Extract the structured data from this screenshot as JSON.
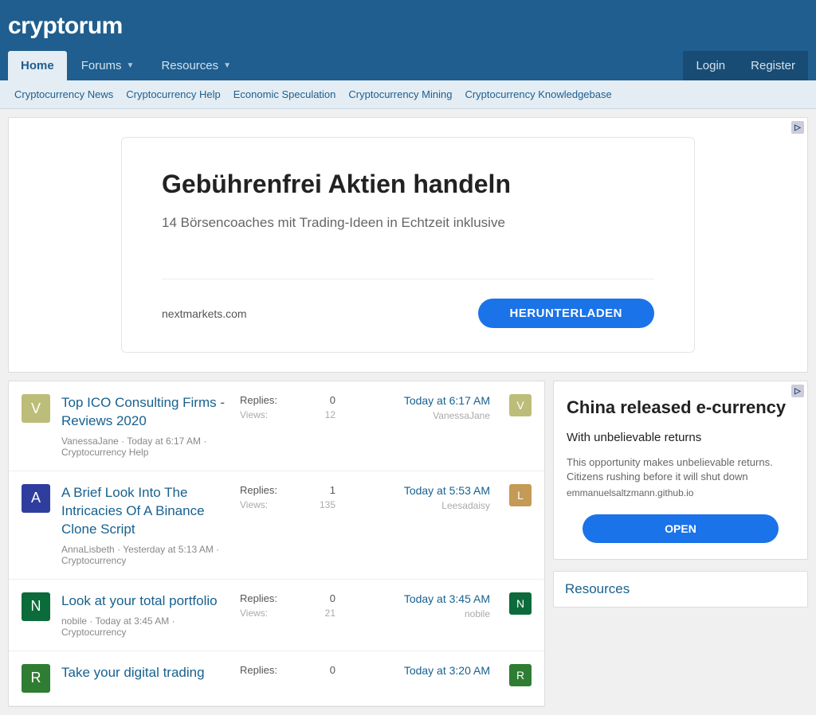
{
  "brand": "cryptorum",
  "nav": {
    "tabs": [
      {
        "label": "Home",
        "active": true,
        "dropdown": false
      },
      {
        "label": "Forums",
        "active": false,
        "dropdown": true
      },
      {
        "label": "Resources",
        "active": false,
        "dropdown": true
      }
    ],
    "login": "Login",
    "register": "Register"
  },
  "subnav": [
    "Cryptocurrency News",
    "Cryptocurrency Help",
    "Economic Speculation",
    "Cryptocurrency Mining",
    "Cryptocurrency Knowledgebase"
  ],
  "top_ad": {
    "title": "Gebührenfrei Aktien handeln",
    "subtitle": "14 Börsencoaches mit Trading-Ideen in Echtzeit inklusive",
    "domain": "nextmarkets.com",
    "cta": "HERUNTERLADEN"
  },
  "labels": {
    "replies": "Replies:",
    "views": "Views:"
  },
  "threads": [
    {
      "title": "Top ICO Consulting Firms - Reviews 2020",
      "author": "VanessaJane",
      "posted": "Today at 6:17 AM",
      "forum": "Cryptocurrency Help",
      "replies": "0",
      "views": "12",
      "last_time": "Today at 6:17 AM",
      "last_user": "VanessaJane",
      "av_letter": "V",
      "av_color": "#bdbd7a",
      "mini_letter": "V",
      "mini_color": "#bdbd7a"
    },
    {
      "title": "A Brief Look Into The Intricacies Of A Binance Clone Script",
      "author": "AnnaLisbeth",
      "posted": "Yesterday at 5:13 AM",
      "forum": "Cryptocurrency",
      "replies": "1",
      "views": "135",
      "last_time": "Today at 5:53 AM",
      "last_user": "Leesadaisy",
      "av_letter": "A",
      "av_color": "#2f3e9e",
      "mini_letter": "L",
      "mini_color": "#c49a54"
    },
    {
      "title": "Look at your total portfolio",
      "author": "nobile",
      "posted": "Today at 3:45 AM",
      "forum": "Cryptocurrency",
      "replies": "0",
      "views": "21",
      "last_time": "Today at 3:45 AM",
      "last_user": "nobile",
      "av_letter": "N",
      "av_color": "#0b6b3a",
      "mini_letter": "N",
      "mini_color": "#0b6b3a"
    },
    {
      "title": "Take your digital trading",
      "author": "",
      "posted": "",
      "forum": "",
      "replies": "0",
      "views": "",
      "last_time": "Today at 3:20 AM",
      "last_user": "",
      "av_letter": "R",
      "av_color": "#2e7d32",
      "mini_letter": "R",
      "mini_color": "#2e7d32"
    }
  ],
  "side_ad": {
    "title": "China released e-currency",
    "subtitle": "With unbelievable returns",
    "body": "This opportunity makes unbelievable returns. Citizens rushing before it will shut down",
    "domain": "emmanuelsaltzmann.github.io",
    "cta": "OPEN"
  },
  "side_panel_title": "Resources",
  "adchoices_glyph": "▷"
}
